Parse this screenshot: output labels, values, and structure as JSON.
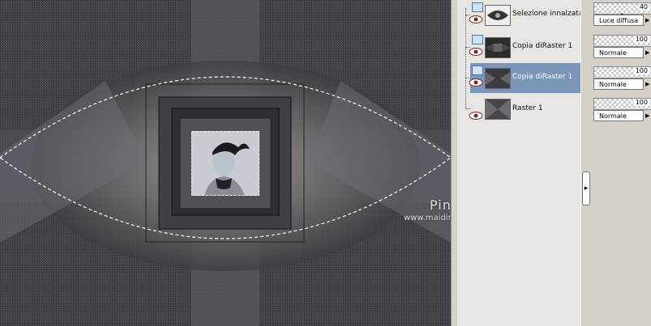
{
  "watermark": {
    "name": "Pinuccia",
    "site": "www.maidiregrafica.eu"
  },
  "layers": [
    {
      "name": "Selezione innalzata",
      "opacity": "40",
      "blend_mode": "Luce diffusa",
      "selected": false,
      "thumb_icon": "selection-thumb-icon"
    },
    {
      "name": "Copia diRaster 1",
      "opacity": "100",
      "blend_mode": "Normale",
      "selected": false,
      "thumb_icon": "raster-thumb-icon"
    },
    {
      "name": "Copia diRaster 1",
      "opacity": "100",
      "blend_mode": "Normale",
      "selected": true,
      "thumb_icon": "raster-thumb-icon"
    },
    {
      "name": "Raster 1",
      "opacity": "100",
      "blend_mode": "Normale",
      "selected": false,
      "thumb_icon": "raster-thumb-icon"
    }
  ],
  "colors": {
    "selected_row": "#7b95bb",
    "panel_bg": "#d4d0c8"
  }
}
